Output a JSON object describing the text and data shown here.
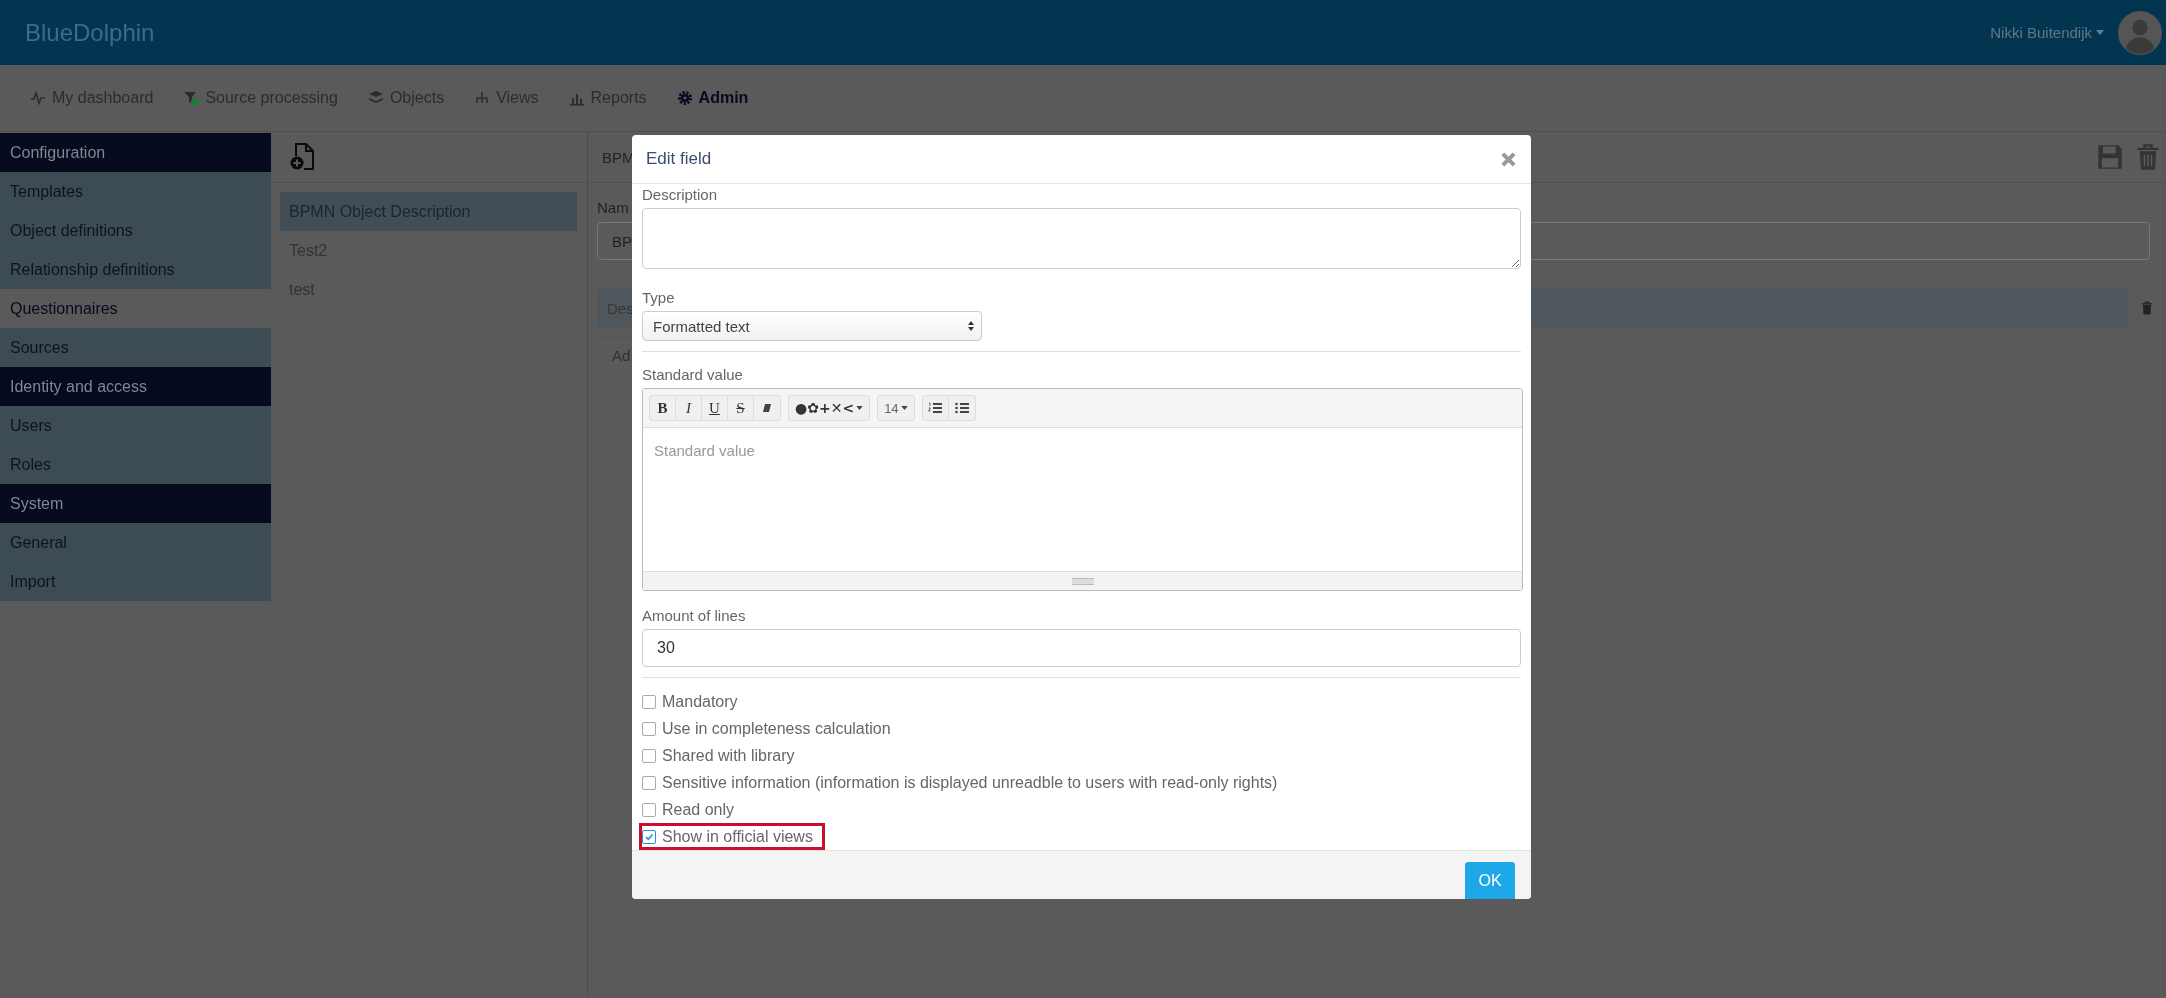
{
  "header": {
    "brand": "BlueDolphin",
    "user": "Nikki Buitendijk"
  },
  "nav": [
    {
      "label": "My dashboard",
      "selected": false
    },
    {
      "label": "Source processing",
      "selected": false
    },
    {
      "label": "Objects",
      "selected": false
    },
    {
      "label": "Views",
      "selected": false
    },
    {
      "label": "Reports",
      "selected": false
    },
    {
      "label": "Admin",
      "selected": true
    }
  ],
  "sidebar": [
    {
      "title": "Configuration",
      "items": [
        {
          "label": "Templates",
          "selected": false
        },
        {
          "label": "Object definitions",
          "selected": false
        },
        {
          "label": "Relationship definitions",
          "selected": false
        },
        {
          "label": "Questionnaires",
          "selected": true
        },
        {
          "label": "Sources",
          "selected": false
        }
      ]
    },
    {
      "title": "Identity and access",
      "items": [
        {
          "label": "Users",
          "selected": false
        },
        {
          "label": "Roles",
          "selected": false
        }
      ]
    },
    {
      "title": "System",
      "items": [
        {
          "label": "General",
          "selected": false
        },
        {
          "label": "Import",
          "selected": false
        }
      ]
    }
  ],
  "questionnaires": [
    {
      "label": "BPMN Object Description",
      "selected": true
    },
    {
      "label": "Test2",
      "selected": false
    },
    {
      "label": "test",
      "selected": false
    }
  ],
  "detail": {
    "title": "BPM",
    "name_label": "Nam",
    "name_value": "BP",
    "field_row": "Des",
    "add_button": "Ad"
  },
  "dialog": {
    "title": "Edit field",
    "description_label": "Description",
    "type_label": "Type",
    "type_value": "Formatted text",
    "standard_label": "Standard value",
    "toolbar": [
      {
        "label": "B",
        "kind": "bold"
      },
      {
        "label": "I",
        "kind": "italic"
      },
      {
        "label": "U",
        "kind": "underline"
      },
      {
        "label": "S",
        "kind": "strike"
      },
      {
        "kind": "eraser"
      },
      {
        "label": "●✿+✕<",
        "kind": "style"
      },
      {
        "label": "14",
        "kind": "size"
      },
      {
        "kind": "ordered"
      },
      {
        "kind": "bullets"
      }
    ],
    "standard_placeholder": "Standard value",
    "lines_label": "Amount of lines",
    "lines_value": "30",
    "options": [
      {
        "label": "Mandatory",
        "checked": false,
        "highlighted": false
      },
      {
        "label": "Use in completeness calculation",
        "checked": false,
        "highlighted": false
      },
      {
        "label": "Shared with library",
        "checked": false,
        "highlighted": false
      },
      {
        "label": "Sensitive information (information is displayed unreadble to users with read-only rights)",
        "checked": false,
        "highlighted": false
      },
      {
        "label": "Read only",
        "checked": false,
        "highlighted": false
      },
      {
        "label": "Show in official views",
        "checked": true,
        "highlighted": true
      }
    ],
    "ok": "OK"
  }
}
